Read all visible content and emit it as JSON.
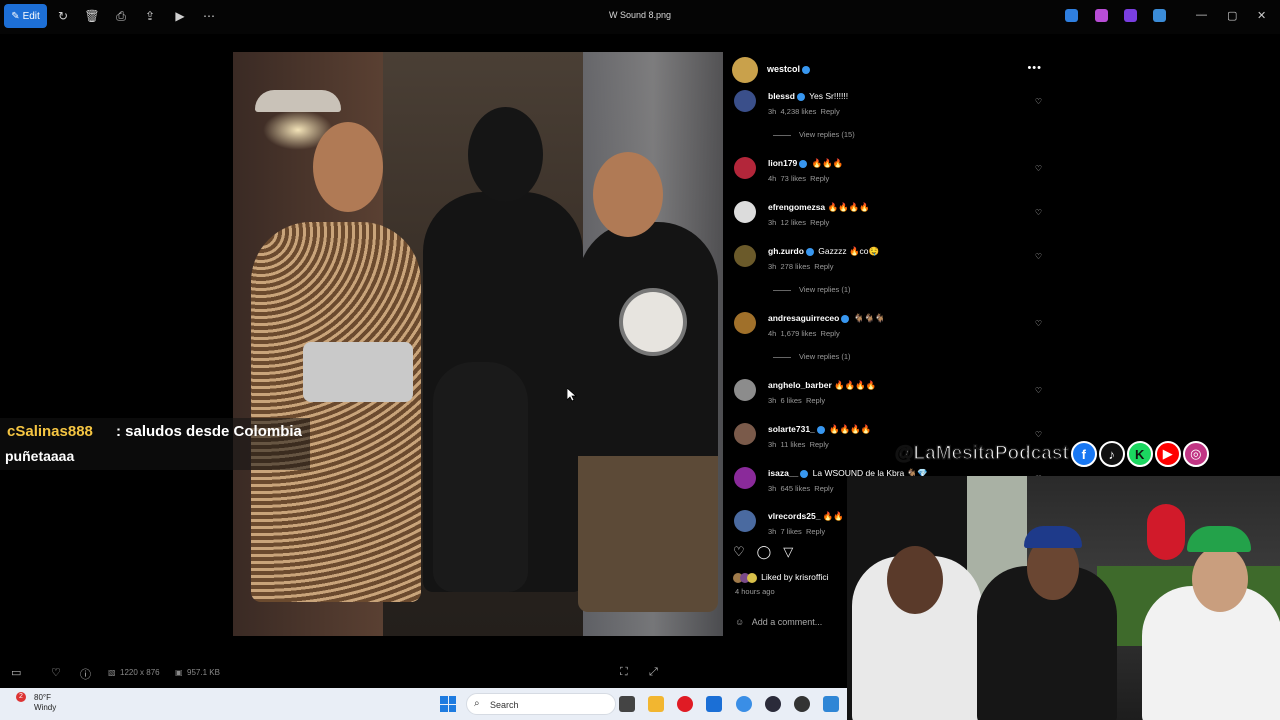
{
  "topbar": {
    "edit_label": "Edit",
    "file_title": "W Sound 8.png"
  },
  "post": {
    "author": "westcol",
    "comments": [
      {
        "user": "blessd",
        "verified": true,
        "text": "Yes Sr!!!!!!",
        "time": "3h",
        "likes": "4,238 likes",
        "reply": "Reply",
        "view_replies": "View replies (15)"
      },
      {
        "user": "lion179",
        "verified": true,
        "text": "🔥🔥🔥",
        "time": "4h",
        "likes": "73 likes",
        "reply": "Reply"
      },
      {
        "user": "efrengomezsa",
        "verified": false,
        "text": "🔥🔥🔥🔥",
        "time": "3h",
        "likes": "12 likes",
        "reply": "Reply"
      },
      {
        "user": "gh.zurdo",
        "verified": true,
        "text": "Gazzzz 🔥co🤤",
        "time": "3h",
        "likes": "278 likes",
        "reply": "Reply",
        "view_replies": "View replies (1)"
      },
      {
        "user": "andresaguirreceo",
        "verified": true,
        "text": "🐐🐐🐐",
        "time": "4h",
        "likes": "1,679 likes",
        "reply": "Reply",
        "view_replies": "View replies (1)"
      },
      {
        "user": "anghelo_barber",
        "verified": false,
        "text": "🔥🔥🔥🔥",
        "time": "3h",
        "likes": "6 likes",
        "reply": "Reply"
      },
      {
        "user": "solarte731_",
        "verified": true,
        "text": "🔥🔥🔥🔥",
        "time": "3h",
        "likes": "11 likes",
        "reply": "Reply"
      },
      {
        "user": "isaza__",
        "verified": true,
        "text": "La WSOUND de la Kbra 🐐💎",
        "time": "3h",
        "likes": "645 likes",
        "reply": "Reply"
      },
      {
        "user": "vlrecords25_",
        "verified": false,
        "text": "🔥🔥",
        "time": "3h",
        "likes": "7 likes",
        "reply": "Reply"
      }
    ],
    "liked_by": "Liked by krisroffici",
    "time_ago": "4 hours ago",
    "add_comment": "Add a comment..."
  },
  "chat": {
    "user": "cSalinas888",
    "message": ": saludos desde Colombia",
    "message2": "puñetaaaa"
  },
  "social": {
    "handle": "@LaMesitaPodcast",
    "icons": [
      "facebook-icon",
      "tiktok-icon",
      "kick-icon",
      "youtube-icon",
      "instagram-icon"
    ]
  },
  "bottom_toolbar": {
    "dimensions": "1220 x 876",
    "file_size": "957.1 KB"
  },
  "taskbar": {
    "temperature": "80°F",
    "condition": "Windy",
    "notification_count": "2",
    "search_label": "Search"
  },
  "colors": {
    "accent": "#1d6fd6",
    "chat_user": "#f5c542",
    "verified": "#3897f0"
  }
}
